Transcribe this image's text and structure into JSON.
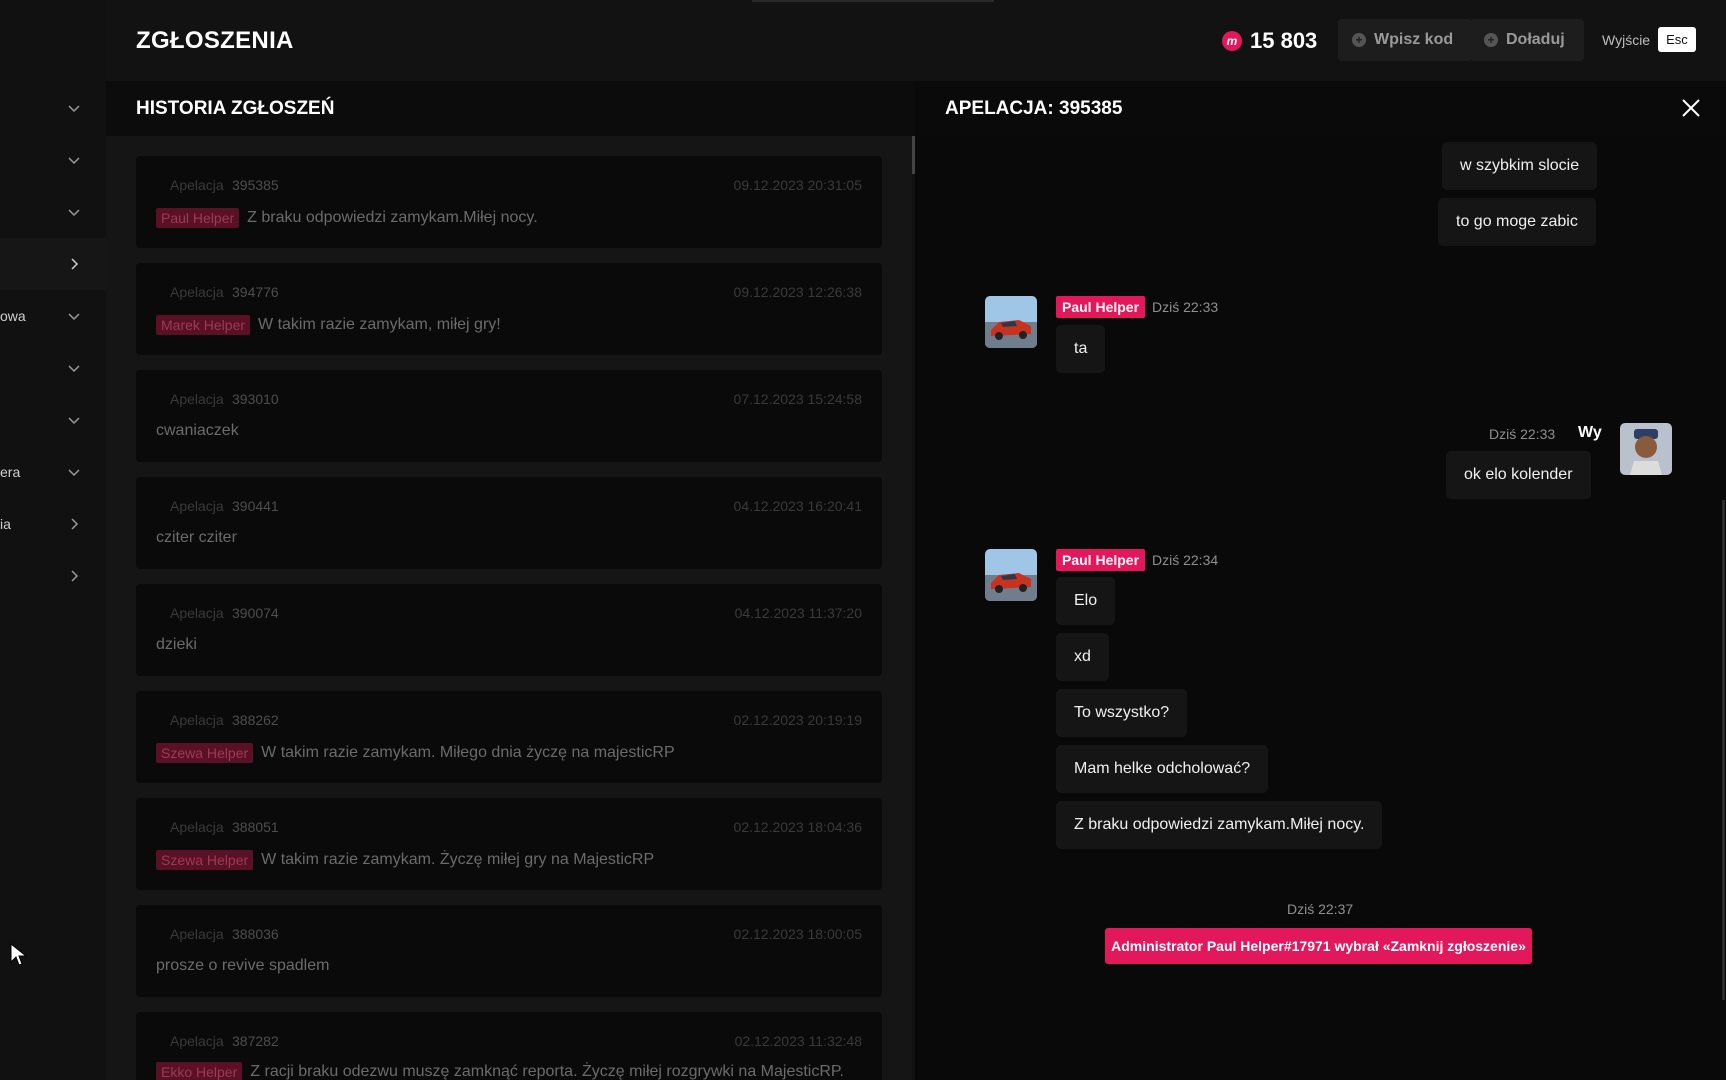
{
  "header": {
    "title": "ZGŁOSZENIA",
    "coins": "15 803",
    "code_button": "Wpisz kod",
    "topup_button": "Doładuj",
    "exit_label": "Wyjście",
    "exit_key": "Esc"
  },
  "sidebar": {
    "items": [
      {
        "label": "",
        "chevron": "down"
      },
      {
        "label": "",
        "chevron": "down"
      },
      {
        "label": "",
        "chevron": "down"
      },
      {
        "label": "",
        "chevron": "right"
      },
      {
        "label": "owa",
        "chevron": "down"
      },
      {
        "label": "",
        "chevron": "down"
      },
      {
        "label": "",
        "chevron": "down"
      },
      {
        "label": "era",
        "chevron": "down"
      },
      {
        "label": "ia",
        "chevron": "right"
      },
      {
        "label": "",
        "chevron": "right"
      }
    ]
  },
  "history": {
    "title": "HISTORIA ZGŁOSZEŃ",
    "tickets": [
      {
        "type": "Apelacja",
        "id": "395385",
        "date": "09.12.2023 20:31:05",
        "helper": "Paul Helper",
        "message": "Z braku odpowiedzi zamykam.Miłej nocy."
      },
      {
        "type": "Apelacja",
        "id": "394776",
        "date": "09.12.2023 12:26:38",
        "helper": "Marek Helper",
        "message": "W takim razie zamykam, miłej gry!"
      },
      {
        "type": "Apelacja",
        "id": "393010",
        "date": "07.12.2023 15:24:58",
        "helper": "",
        "message": "cwaniaczek"
      },
      {
        "type": "Apelacja",
        "id": "390441",
        "date": "04.12.2023 16:20:41",
        "helper": "",
        "message": "cziter cziter"
      },
      {
        "type": "Apelacja",
        "id": "390074",
        "date": "04.12.2023 11:37:20",
        "helper": "",
        "message": "dzieki"
      },
      {
        "type": "Apelacja",
        "id": "388262",
        "date": "02.12.2023 20:19:19",
        "helper": "Szewa Helper",
        "message": "W takim razie zamykam. Miłego dnia życzę na majesticRP"
      },
      {
        "type": "Apelacja",
        "id": "388051",
        "date": "02.12.2023 18:04:36",
        "helper": "Szewa Helper",
        "message": "W takim razie zamykam. Życzę miłej gry na MajesticRP"
      },
      {
        "type": "Apelacja",
        "id": "388036",
        "date": "02.12.2023 18:00:05",
        "helper": "",
        "message": "prosze o revive spadlem"
      },
      {
        "type": "Apelacja",
        "id": "387282",
        "date": "02.12.2023 11:32:48",
        "helper": "Ekko Helper",
        "message": "Z racji braku odezwu muszę zamknąć reporta. Życzę miłej rozgrywki na MajesticRP."
      }
    ]
  },
  "chat": {
    "title": "APELACJA: 395385",
    "own_messages_top": [
      "w szybkim slocie",
      "to go moge zabic"
    ],
    "group1": {
      "sender": "Paul Helper",
      "time": "Dziś 22:33",
      "messages": [
        "ta"
      ]
    },
    "own_group": {
      "sender": "Wy",
      "time": "Dziś 22:33",
      "messages": [
        "ok elo kolender"
      ]
    },
    "group2": {
      "sender": "Paul Helper",
      "time": "Dziś 22:34",
      "messages": [
        "Elo",
        "xd",
        "To wszystko?",
        "Mam helke odcholować?",
        "Z braku odpowiedzi zamykam.Miłej nocy."
      ]
    },
    "system": {
      "time": "Dziś 22:37",
      "text": "Administrator Paul Helper#17971 wybrał «Zamknij zgłoszenie»"
    }
  },
  "colors": {
    "accent": "#e3175b",
    "panel": "#151515",
    "background": "#0b0b0b"
  }
}
